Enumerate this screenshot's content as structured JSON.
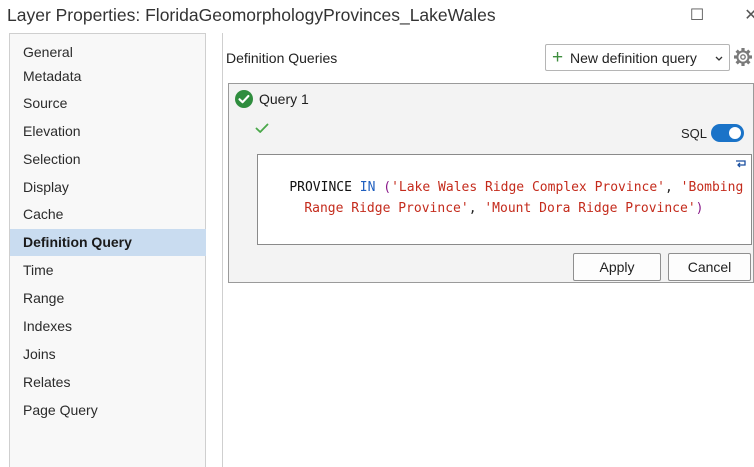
{
  "window": {
    "title": "Layer Properties: FloridaGeomorphologyProvinces_LakeWales",
    "maximize_glyph": "☐",
    "close_glyph": "✕"
  },
  "sidebar": {
    "items": [
      {
        "label": "General"
      },
      {
        "label": "Metadata"
      },
      {
        "label": "Source"
      },
      {
        "label": "Elevation"
      },
      {
        "label": "Selection"
      },
      {
        "label": "Display"
      },
      {
        "label": "Cache"
      },
      {
        "label": "Definition Query",
        "active": true
      },
      {
        "label": "Time"
      },
      {
        "label": "Range"
      },
      {
        "label": "Indexes"
      },
      {
        "label": "Joins"
      },
      {
        "label": "Relates"
      },
      {
        "label": "Page Query"
      }
    ]
  },
  "main": {
    "section_title": "Definition Queries",
    "new_query_button": {
      "icon": "plus-icon",
      "label": "New definition query"
    },
    "settings_icon": "gear-icon"
  },
  "query": {
    "title": "Query 1",
    "status_icon": "check-circle-icon",
    "valid_icon": "checkmark-icon",
    "sql_label": "SQL",
    "sql_toggle_on": true,
    "sql_tokens_line1": [
      {
        "text": "PROVINCE",
        "kind": "field"
      },
      {
        "text": " IN ",
        "kind": "op"
      },
      {
        "text": "(",
        "kind": "punc"
      },
      {
        "text": "'Lake Wales Ridge Complex Province'",
        "kind": "str"
      },
      {
        "text": ", ",
        "kind": "plain"
      },
      {
        "text": "'Bombing",
        "kind": "str"
      }
    ],
    "sql_tokens_line2": [
      {
        "text": "Range Ridge Province'",
        "kind": "str"
      },
      {
        "text": ", ",
        "kind": "plain"
      },
      {
        "text": "'Mount Dora Ridge Province'",
        "kind": "str"
      },
      {
        "text": ")",
        "kind": "punc"
      }
    ],
    "wrap_icon": "word-wrap-icon",
    "apply_label": "Apply",
    "cancel_label": "Cancel"
  },
  "colors": {
    "accent": "#1a73c8",
    "success": "#2f8d3e",
    "selection": "#c9dcf0",
    "sql_string": "#c42b1c",
    "sql_keyword": "#1f5fbf"
  }
}
